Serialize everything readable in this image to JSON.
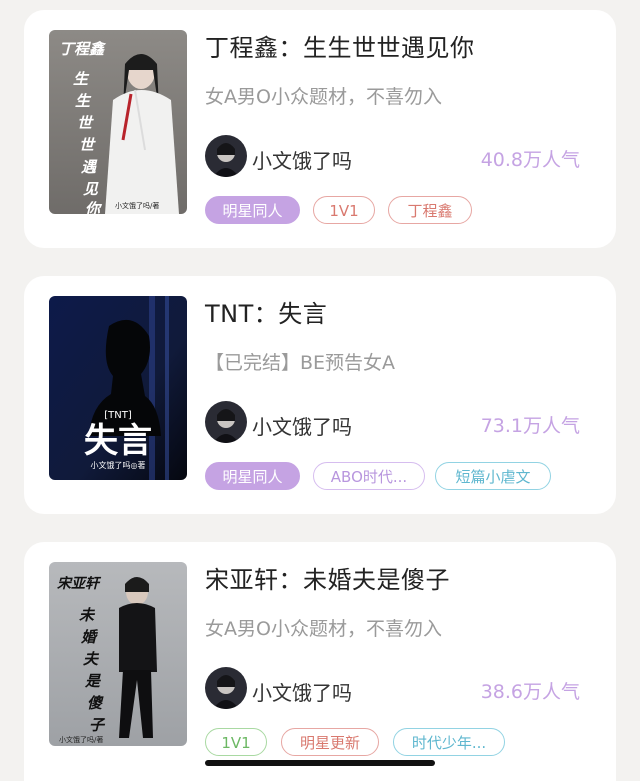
{
  "books": [
    {
      "title": "丁程鑫：生生世世遇见你",
      "summary": "女A男O小众题材，不喜勿入",
      "author": "小文饿了吗",
      "popularity": "40.8万人气",
      "tags": [
        "明星同人",
        "1V1",
        "丁程鑫"
      ],
      "cover": {
        "name": "丁程鑫",
        "title_vertical": "生生世世遇见你",
        "credit": "小文饿了吗/著"
      }
    },
    {
      "title": "TNT：失言",
      "summary": "【已完结】BE预告女A",
      "author": "小文饿了吗",
      "popularity": "73.1万人气",
      "tags": [
        "明星同人",
        "ABO时代...",
        "短篇小虐文"
      ],
      "cover": {
        "name": "[TNT]",
        "title_big": "失言",
        "credit": "小文饿了吗◎著"
      }
    },
    {
      "title": "宋亚轩：未婚夫是傻子",
      "summary": "女A男O小众题材，不喜勿入",
      "author": "小文饿了吗",
      "popularity": "38.6万人气",
      "tags": [
        "1V1",
        "明星更新",
        "时代少年..."
      ],
      "cover": {
        "name": "宋亚轩",
        "title_vertical": "未婚夫是傻子",
        "credit": "小文饿了吗/著"
      }
    }
  ],
  "colors": {
    "accent_purple": "#c5a3e3",
    "background": "#f3f2f0",
    "card": "#ffffff"
  }
}
